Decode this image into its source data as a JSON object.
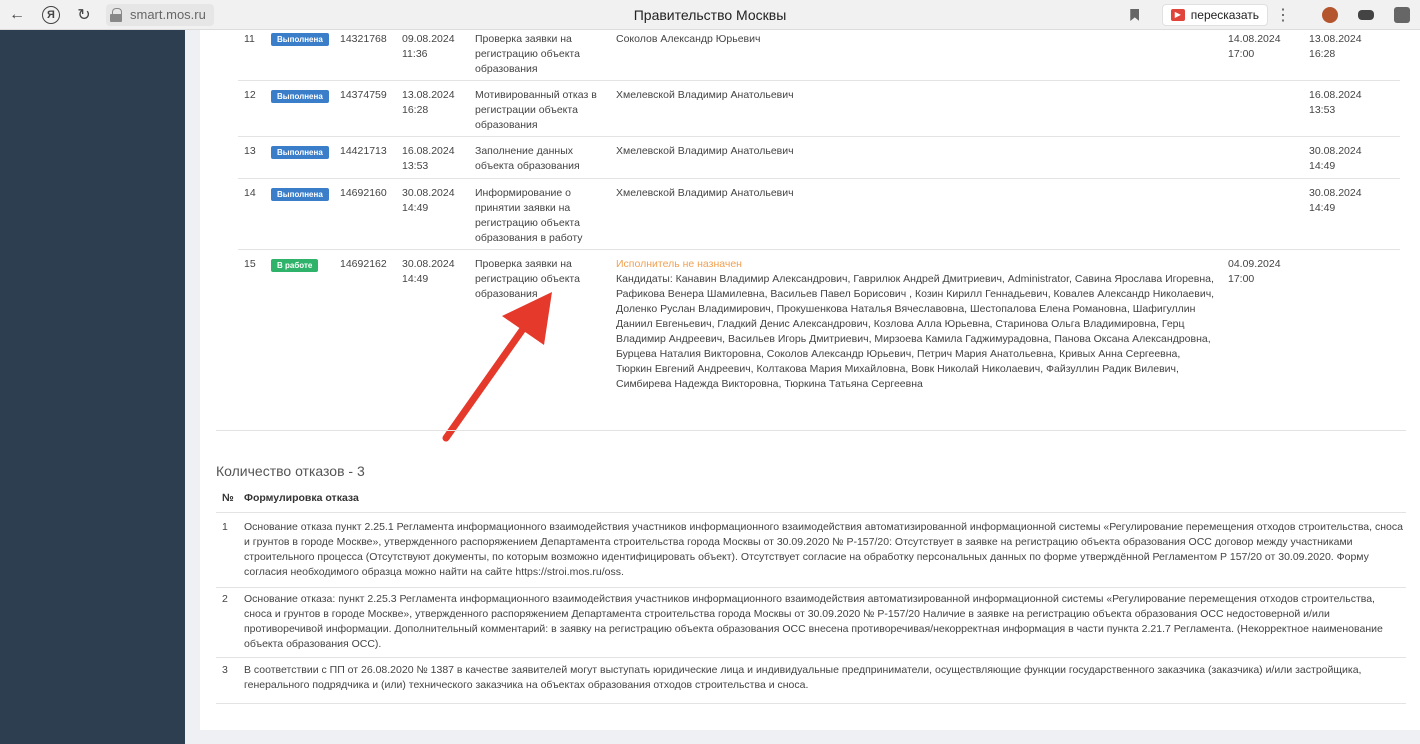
{
  "browser": {
    "url": "smart.mos.ru",
    "title": "Правительство Москвы",
    "translate_label": "пересказать",
    "menu_dots": "⋮"
  },
  "history": {
    "rows": [
      {
        "num": "11",
        "status": "Выполнена",
        "id": "14321768",
        "date": "09.08.2024 11:36",
        "stage": "Проверка заявки на регистрацию объекта образования",
        "executor": "Соколов Александр Юрьевич",
        "due": "14.08.2024 17:00",
        "finished": "13.08.2024 16:28"
      },
      {
        "num": "12",
        "status": "Выполнена",
        "id": "14374759",
        "date": "13.08.2024 16:28",
        "stage": "Мотивированный отказ в регистрации объекта образования",
        "executor": "Хмелевской Владимир Анатольевич",
        "due": "",
        "finished": "16.08.2024 13:53"
      },
      {
        "num": "13",
        "status": "Выполнена",
        "id": "14421713",
        "date": "16.08.2024 13:53",
        "stage": "Заполнение данных объекта образования",
        "executor": "Хмелевской Владимир Анатольевич",
        "due": "",
        "finished": "30.08.2024 14:49"
      },
      {
        "num": "14",
        "status": "Выполнена",
        "id": "14692160",
        "date": "30.08.2024 14:49",
        "stage": "Информирование о принятии заявки на регистрацию объекта образования в работу",
        "executor": "Хмелевской Владимир Анатольевич",
        "due": "",
        "finished": "30.08.2024 14:49"
      },
      {
        "num": "15",
        "status": "В работе",
        "id": "14692162",
        "date": "30.08.2024 14:49",
        "stage": "Проверка заявки на регистрацию объекта образования",
        "executor_unassigned": "Исполнитель не назначен",
        "executor": "Кандидаты: Канавин Владимир Александрович, Гаврилюк Андрей Дмитриевич, Administrator, Савина Ярослава Игоревна, Рафикова Венера Шамилевна, Васильев Павел Борисович , Козин Кирилл Геннадьевич, Ковалев Александр Николаевич, Доленко Руслан Владимирович, Прокушенкова Наталья Вячеславовна, Шестопалова Елена Романовна, Шафигуллин Даниил Евгеньевич, Гладкий Денис Александрович, Козлова Алла Юрьевна, Старинова Ольга Владимировна, Герц Владимир Андреевич, Васильев Игорь Дмитриевич, Мирзоева Камила Гаджимурадовна, Панова Оксана Александровна, Бурцева Наталия Викторовна, Соколов Александр Юрьевич, Петрич Мария Анатольевна, Кривых Анна Сергеевна, Тюркин Евгений Андреевич, Колтакова Мария Михайловна, Вовк Николай Николаевич, Файзуллин Радик Вилевич, Симбирева Надежда Викторовна, Тюркина Татьяна Сергеевна",
        "due": "04.09.2024 17:00",
        "finished": ""
      }
    ]
  },
  "refusals": {
    "title": "Количество отказов - 3",
    "col_num": "№",
    "col_text": "Формулировка отказа",
    "rows": [
      {
        "num": "1",
        "text": "Основание отказа пункт 2.25.1 Регламента информационного взаимодействия участников информационного взаимодействия автоматизированной информационной системы «Регулирование перемещения отходов строительства, сноса и грунтов в городе Москве», утвержденного распоряжением Департамента строительства города Москвы от 30.09.2020 № Р-157/20: Отсутствует в заявке на регистрацию объекта образования ОСС договор между участниками строительного процесса (Отсутствуют документы, по которым возможно идентифицировать объект). Отсутствует согласие на обработку персональных данных по форме утверждённой Регламентом Р 157/20 от 30.09.2020. Форму согласия необходимого образца можно найти на сайте https://stroi.mos.ru/oss."
      },
      {
        "num": "2",
        "text": "Основание отказа: пункт 2.25.3 Регламента информационного взаимодействия участников информационного взаимодействия автоматизированной информационной системы «Регулирование перемещения отходов строительства, сноса и грунтов в городе Москве», утвержденного распоряжением Департамента строительства города Москвы от 30.09.2020 № Р-157/20 Наличие в заявке на регистрацию объекта образования ОСС недостоверной и/или противоречивой информации. Дополнительный комментарий: в заявку на регистрацию объекта образования ОСС внесена противоречивая/некорректная информация в части пункта 2.21.7 Регламента. (Некорректное наименование объекта образования ОСС)."
      },
      {
        "num": "3",
        "text": "В соответствии с ПП от 26.08.2020 № 1387 в качестве заявителей могут выступать юридические лица и индивидуальные предприниматели, осуществляющие функции государственного заказчика (заказчика) и/или застройщика, генерального подрядчика и (или) технического заказчика на объектах образования отходов строительства и сноса."
      }
    ]
  },
  "colors": {
    "sidebar": "#2c3e50",
    "badge_done": "#3a7dc9",
    "badge_work": "#2fb36a",
    "unassigned": "#f0a050",
    "arrow": "#e5392b"
  }
}
